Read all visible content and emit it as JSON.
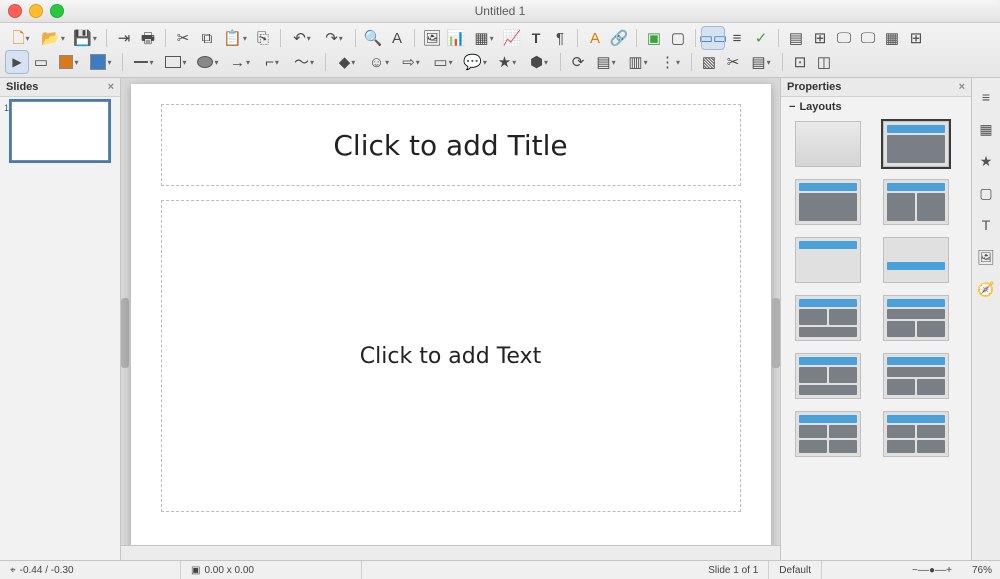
{
  "window": {
    "title": "Untitled 1"
  },
  "slides_panel": {
    "header": "Slides",
    "slides": [
      {
        "number": "1"
      }
    ]
  },
  "editor": {
    "title_placeholder": "Click to add Title",
    "text_placeholder": "Click to add Text"
  },
  "properties_panel": {
    "header": "Properties",
    "section": "Layouts",
    "layouts": [
      {
        "name": "blank"
      },
      {
        "name": "title-content",
        "selected": true
      },
      {
        "name": "title-content-alt"
      },
      {
        "name": "title-two-content"
      },
      {
        "name": "title-only"
      },
      {
        "name": "centered-text"
      },
      {
        "name": "two-content-above"
      },
      {
        "name": "content-two-above"
      },
      {
        "name": "two-content-below"
      },
      {
        "name": "four-content"
      },
      {
        "name": "six-content-a"
      },
      {
        "name": "six-content-b"
      }
    ]
  },
  "side_tabs": {
    "items": [
      {
        "icon": "sliders"
      },
      {
        "icon": "gallery"
      },
      {
        "icon": "target"
      },
      {
        "icon": "shape"
      },
      {
        "icon": "image"
      },
      {
        "icon": "nav"
      }
    ]
  },
  "statusbar": {
    "coords": "-0.44 / -0.30",
    "size": "0.00 x 0.00",
    "slide": "Slide 1 of 1",
    "master": "Default",
    "zoom": "76%"
  },
  "toolbar1": [
    {
      "name": "new",
      "glyph": "🗋",
      "dd": true,
      "cl": true
    },
    {
      "name": "open",
      "glyph": "📂",
      "dd": true
    },
    {
      "name": "save",
      "glyph": "💾",
      "dd": true
    },
    {
      "type": "sep"
    },
    {
      "name": "export",
      "glyph": "⇥"
    },
    {
      "name": "print",
      "glyph": "🖶"
    },
    {
      "type": "sep"
    },
    {
      "name": "cut",
      "glyph": "✂"
    },
    {
      "name": "copy",
      "glyph": "⧉"
    },
    {
      "name": "paste",
      "glyph": "📋",
      "dd": true
    },
    {
      "name": "clone",
      "glyph": "⎘"
    },
    {
      "type": "sep"
    },
    {
      "name": "undo",
      "glyph": "↶",
      "dd": true
    },
    {
      "name": "redo",
      "glyph": "↷",
      "dd": true
    },
    {
      "type": "sep"
    },
    {
      "name": "find",
      "glyph": "🔍"
    },
    {
      "name": "spell",
      "glyph": "A"
    },
    {
      "type": "sep"
    },
    {
      "name": "insert-image",
      "glyph": "🖼"
    },
    {
      "name": "insert-chart",
      "glyph": "📊"
    },
    {
      "name": "insert-table",
      "glyph": "▦",
      "dd": true
    },
    {
      "name": "insert-chart2",
      "glyph": "📈"
    },
    {
      "name": "insert-text",
      "glyph": "T",
      "text": true
    },
    {
      "name": "insert-special",
      "glyph": "¶"
    },
    {
      "type": "sep"
    },
    {
      "name": "fontwork",
      "glyph": "A",
      "cl": true
    },
    {
      "name": "link",
      "glyph": "🔗"
    },
    {
      "type": "sep"
    },
    {
      "name": "present-start",
      "glyph": "▣",
      "green": true
    },
    {
      "name": "present-current",
      "glyph": "▢"
    },
    {
      "type": "sep"
    },
    {
      "name": "views-normal",
      "glyph": "▭▭",
      "selected": true,
      "blue": true
    },
    {
      "name": "views-outline",
      "glyph": "≡"
    },
    {
      "name": "views-notes",
      "glyph": "✓",
      "green": true
    },
    {
      "type": "sep"
    },
    {
      "name": "master",
      "glyph": "▤"
    },
    {
      "name": "handout",
      "glyph": "⊞"
    },
    {
      "name": "display",
      "glyph": "🖵"
    },
    {
      "name": "display2",
      "glyph": "🖵"
    },
    {
      "name": "views-sorter",
      "glyph": "▦"
    },
    {
      "name": "extra",
      "glyph": "⊞"
    }
  ],
  "toolbar2": [
    {
      "name": "pointer",
      "glyph": "▶",
      "sm": true,
      "selected": true
    },
    {
      "name": "zoom-page",
      "glyph": "▭"
    },
    {
      "name": "line-color",
      "swatch": true,
      "dd": true
    },
    {
      "name": "fill-color",
      "fillswatch": true,
      "dd": true
    },
    {
      "type": "sep"
    },
    {
      "name": "line-tool",
      "line": true,
      "dd": true
    },
    {
      "name": "rect-tool",
      "rect": true,
      "dd": true
    },
    {
      "name": "ellipse-tool",
      "oval": true,
      "dd": true
    },
    {
      "name": "arrow-tool",
      "glyph": "→",
      "dd": true
    },
    {
      "name": "conn-tool",
      "glyph": "⌐",
      "dd": true
    },
    {
      "name": "curve-tool",
      "glyph": "～",
      "dd": true
    },
    {
      "type": "sep"
    },
    {
      "name": "basic-shapes",
      "glyph": "◆",
      "dd": true
    },
    {
      "name": "symbol-shapes",
      "glyph": "☺",
      "dd": true
    },
    {
      "name": "arrow-shapes",
      "glyph": "⇨",
      "dd": true
    },
    {
      "name": "flowchart",
      "glyph": "▭",
      "dd": true
    },
    {
      "name": "callouts",
      "glyph": "💬",
      "dd": true
    },
    {
      "name": "stars",
      "glyph": "★",
      "dd": true
    },
    {
      "name": "3d",
      "glyph": "⬢",
      "dd": true
    },
    {
      "type": "sep"
    },
    {
      "name": "rotate",
      "glyph": "⟳"
    },
    {
      "name": "align",
      "glyph": "▤",
      "dd": true
    },
    {
      "name": "arrange",
      "glyph": "▥",
      "dd": true
    },
    {
      "name": "distribute",
      "glyph": "⋮",
      "dd": true
    },
    {
      "type": "sep"
    },
    {
      "name": "shadow",
      "glyph": "▧"
    },
    {
      "name": "crop",
      "glyph": "✂"
    },
    {
      "name": "filter",
      "glyph": "▤",
      "dd": true
    },
    {
      "type": "sep"
    },
    {
      "name": "glue",
      "glyph": "⊡"
    },
    {
      "name": "toggle-extrusion",
      "glyph": "◫"
    }
  ]
}
